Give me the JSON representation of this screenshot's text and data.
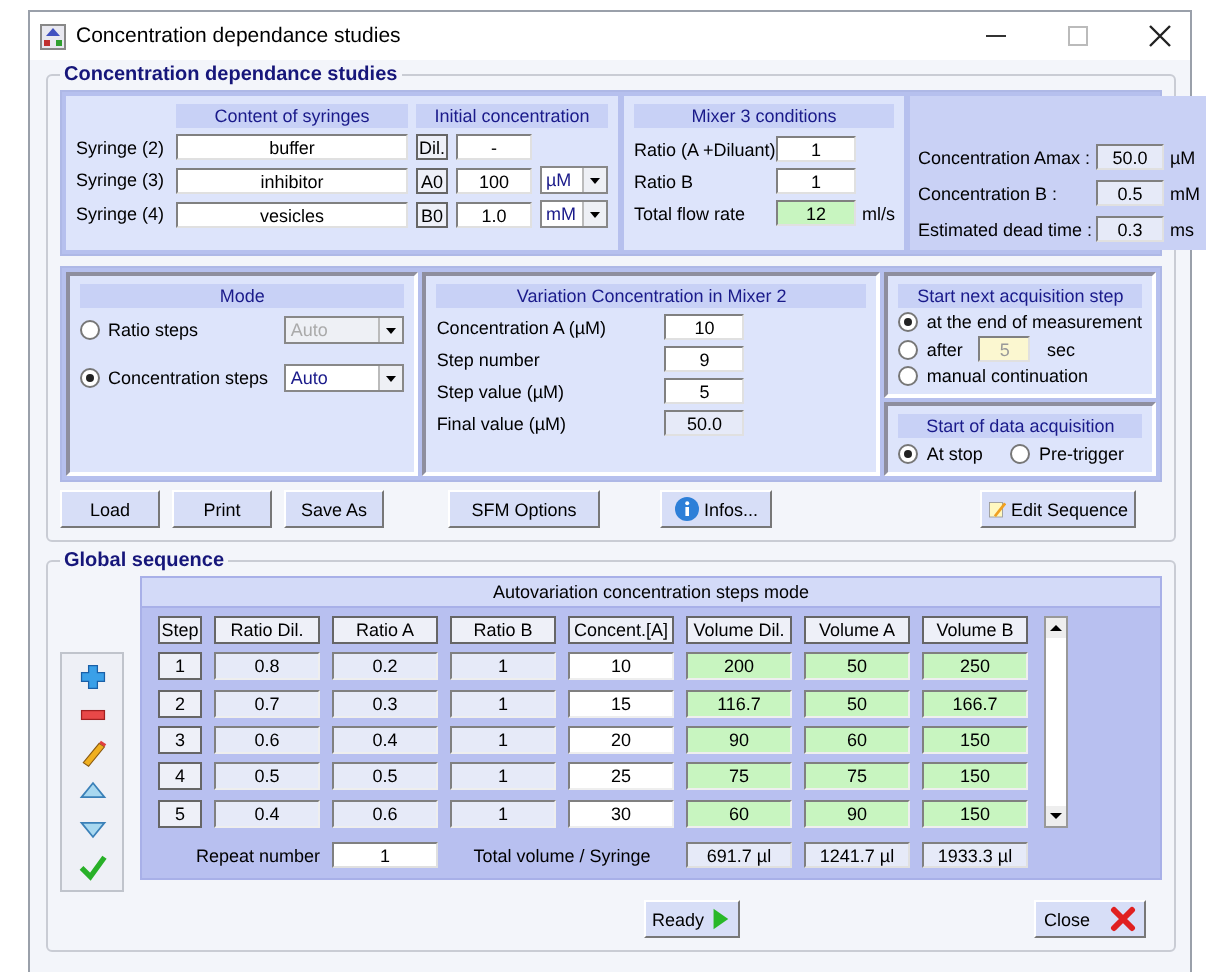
{
  "window": {
    "title": "Concentration dependance studies"
  },
  "study": {
    "title": "Concentration dependance studies",
    "syringes": {
      "content_header": "Content of syringes",
      "concentration_header": "Initial concentration",
      "rows": [
        {
          "label": "Syringe (2)",
          "content": "buffer",
          "tag": "Dil.",
          "concentration": "-"
        },
        {
          "label": "Syringe (3)",
          "content": "inhibitor",
          "tag": "A0",
          "concentration": "100",
          "unit": "µM"
        },
        {
          "label": "Syringe (4)",
          "content": "vesicles",
          "tag": "B0",
          "concentration": "1.0",
          "unit": "mM"
        }
      ]
    },
    "mixer3": {
      "title": "Mixer 3 conditions",
      "rows": [
        {
          "label": "Ratio (A +Diluant)",
          "value": "1",
          "kind": "input"
        },
        {
          "label": "Ratio B",
          "value": "1",
          "kind": "input"
        },
        {
          "label": "Total flow rate",
          "value": "12",
          "unit": "ml/s",
          "kind": "computed"
        }
      ]
    },
    "results": [
      {
        "label": "Concentration Amax :",
        "value": "50.0",
        "unit": "µM"
      },
      {
        "label": "Concentration B :",
        "value": "0.5",
        "unit": "mM"
      },
      {
        "label": "Estimated dead time :",
        "value": "0.3",
        "unit": "ms"
      }
    ],
    "mode": {
      "title": "Mode",
      "options": [
        {
          "label": "Ratio steps",
          "selected": false,
          "dropdown": "Auto",
          "disabled": true
        },
        {
          "label": "Concentration steps",
          "selected": true,
          "dropdown": "Auto",
          "disabled": false
        }
      ]
    },
    "variation": {
      "title": "Variation Concentration in Mixer 2",
      "rows": [
        {
          "label": "Concentration A (µM)",
          "value": "10",
          "kind": "input"
        },
        {
          "label": "Step number",
          "value": "9",
          "kind": "input"
        },
        {
          "label": "Step value (µM)",
          "value": "5",
          "kind": "input"
        },
        {
          "label": "Final value (µM)",
          "value": "50.0",
          "kind": "readonly"
        }
      ]
    },
    "start_next": {
      "title": "Start next acquisition step",
      "options": [
        {
          "label": "at the end of measurement",
          "selected": true
        },
        {
          "label": "after",
          "selected": false,
          "field": "5",
          "suffix": "sec"
        },
        {
          "label": "manual continuation",
          "selected": false
        }
      ]
    },
    "start_data": {
      "title": "Start of data acquisition",
      "options": [
        {
          "label": "At stop",
          "selected": true
        },
        {
          "label": "Pre-trigger",
          "selected": false
        }
      ]
    },
    "buttons": [
      {
        "label": "Load",
        "kind": "plain"
      },
      {
        "label": "Print",
        "kind": "plain"
      },
      {
        "label": "Save As",
        "kind": "plain"
      },
      {
        "label": "SFM Options",
        "kind": "plain"
      },
      {
        "label": "Infos...",
        "kind": "info"
      },
      {
        "label": "Edit Sequence",
        "kind": "edit"
      }
    ]
  },
  "sequence": {
    "title": "Global sequence",
    "caption": "Autovariation concentration steps mode",
    "columns": [
      {
        "label": "Step",
        "kind": "index"
      },
      {
        "label": "Ratio Dil.",
        "kind": "readonly"
      },
      {
        "label": "Ratio A",
        "kind": "readonly"
      },
      {
        "label": "Ratio B",
        "kind": "readonly"
      },
      {
        "label": "Concent.[A]",
        "kind": "input"
      },
      {
        "label": "Volume Dil.",
        "kind": "computed"
      },
      {
        "label": "Volume A",
        "kind": "computed"
      },
      {
        "label": "Volume B",
        "kind": "computed"
      }
    ],
    "rows": [
      [
        "1",
        "0.8",
        "0.2",
        "1",
        "10",
        "200",
        "50",
        "250"
      ],
      [
        "2",
        "0.7",
        "0.3",
        "1",
        "15",
        "116.7",
        "50",
        "166.7"
      ],
      [
        "3",
        "0.6",
        "0.4",
        "1",
        "20",
        "90",
        "60",
        "150"
      ],
      [
        "4",
        "0.5",
        "0.5",
        "1",
        "25",
        "75",
        "75",
        "150"
      ],
      [
        "5",
        "0.4",
        "0.6",
        "1",
        "30",
        "60",
        "90",
        "150"
      ]
    ],
    "repeat_label": "Repeat number",
    "repeat_value": "1",
    "total_label": "Total volume / Syringe",
    "totals": [
      "691.7 µl",
      "1241.7 µl",
      "1933.3 µl"
    ]
  },
  "footer_buttons": [
    {
      "label": "Ready",
      "kind": "ready"
    },
    {
      "label": "Close",
      "kind": "close"
    }
  ]
}
